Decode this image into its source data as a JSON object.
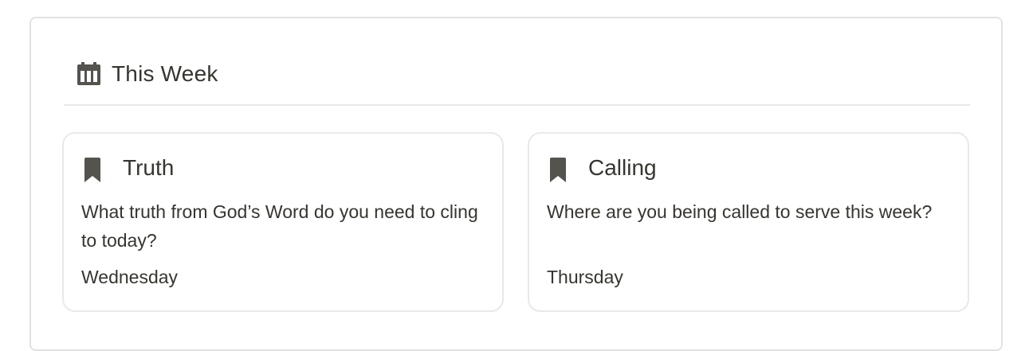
{
  "section": {
    "title": "This Week",
    "icon": "calendar-icon"
  },
  "cards": [
    {
      "icon": "bookmark-icon",
      "title": "Truth",
      "question": "What truth from God’s Word do you need to cling to today?",
      "day": "Wednesday"
    },
    {
      "icon": "bookmark-icon",
      "title": "Calling",
      "question": "Where are you being called to serve this week?",
      "day": "Thursday"
    }
  ],
  "colors": {
    "text": "#37352f",
    "icon": "#55534e",
    "border": "#e3e2e0"
  }
}
